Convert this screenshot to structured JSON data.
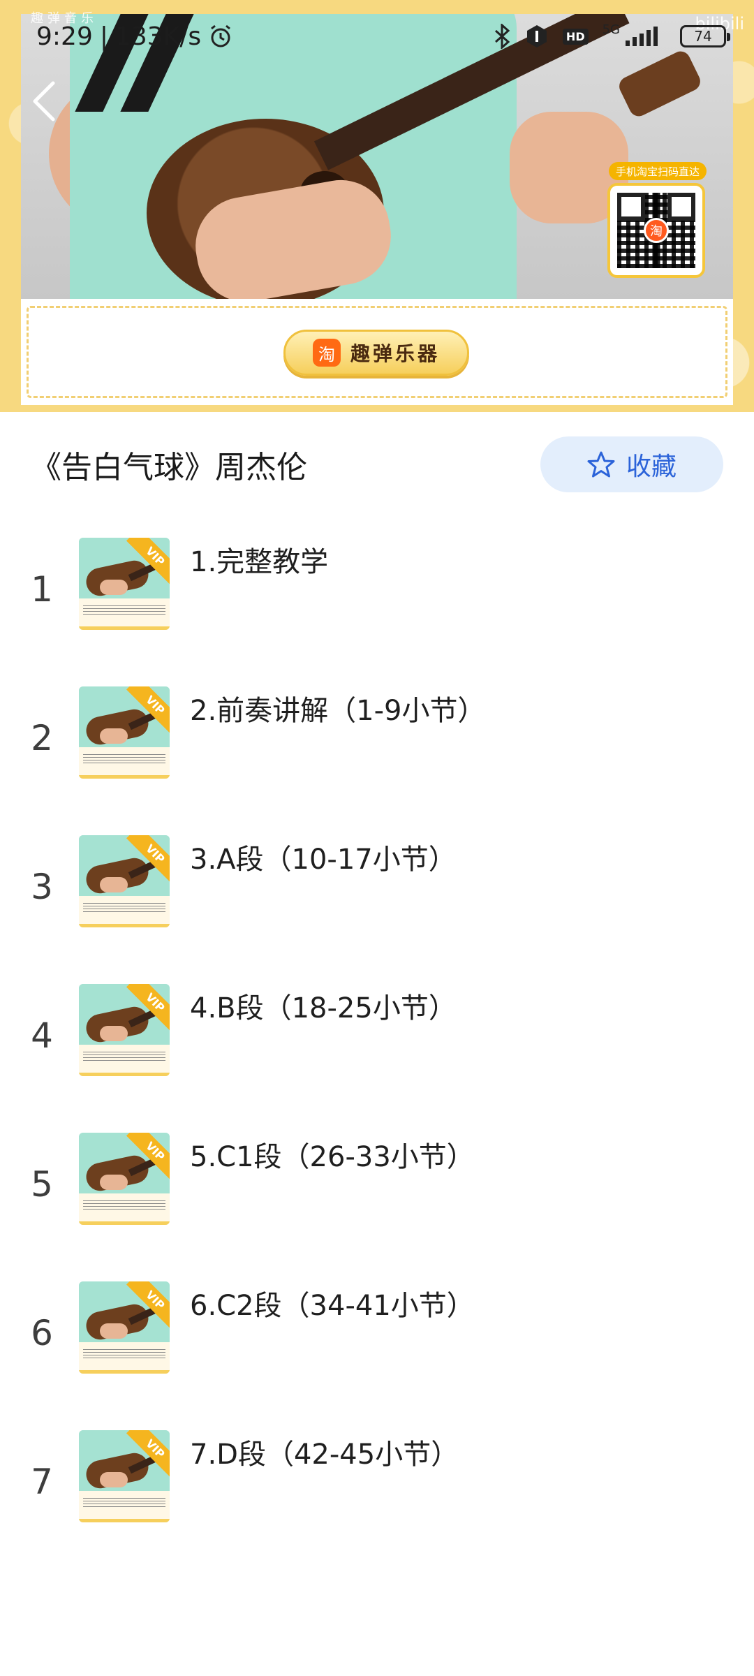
{
  "status_bar": {
    "time": "9:29",
    "speed": "133K/s",
    "network": "5G",
    "hd": "HD",
    "battery": "74"
  },
  "video": {
    "watermark_left": "趣弹音乐",
    "watermark_right": "bilibili",
    "qr_caption": "手机淘宝扫码直达",
    "qr_center": "淘",
    "brand_logo": "淘",
    "brand_name": "趣弹乐器"
  },
  "header": {
    "title": "《告白气球》周杰伦",
    "favorite_label": "收藏"
  },
  "episodes": [
    {
      "index": "1",
      "label": "1.完整教学",
      "badge": "VIP"
    },
    {
      "index": "2",
      "label": "2.前奏讲解（1-9小节）",
      "badge": "VIP"
    },
    {
      "index": "3",
      "label": "3.A段（10-17小节）",
      "badge": "VIP"
    },
    {
      "index": "4",
      "label": "4.B段（18-25小节）",
      "badge": "VIP"
    },
    {
      "index": "5",
      "label": "5.C1段（26-33小节）",
      "badge": "VIP"
    },
    {
      "index": "6",
      "label": "6.C2段（34-41小节）",
      "badge": "VIP"
    },
    {
      "index": "7",
      "label": "7.D段（42-45小节）",
      "badge": "VIP"
    }
  ],
  "colors": {
    "accent": "#2b63d9",
    "favorite_bg": "#e3eefc",
    "frame_yellow": "#f7d980",
    "vip": "#f5b51f"
  },
  "icons": {
    "back": "chevron-left-icon",
    "favorite": "star-outline-icon",
    "bluetooth": "bluetooth-icon",
    "nfc": "nfc-icon",
    "signal": "signal-icon",
    "alarm": "alarm-icon"
  }
}
